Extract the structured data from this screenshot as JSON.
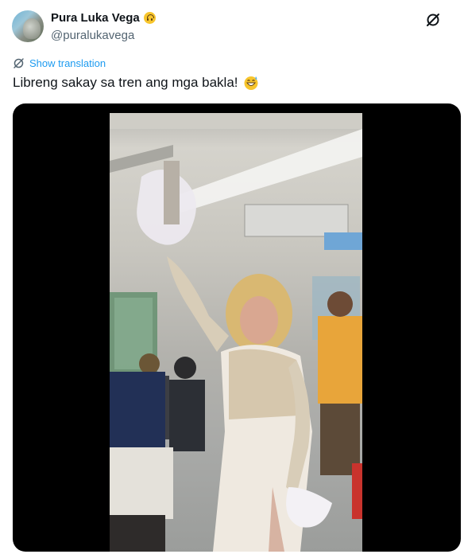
{
  "author": {
    "display_name": "Pura Luka Vega",
    "name_emoji": "upside-down-face-emoji",
    "handle": "@puralukavega",
    "avatar": "avatar-photo"
  },
  "header": {
    "grok_icon": "grok-icon"
  },
  "translation": {
    "icon": "translate-icon",
    "label": "Show translation"
  },
  "tweet": {
    "text": "Libreng sakay sa tren ang mga bakla!",
    "emoji": "grinning-face-with-sweat-emoji"
  },
  "media": {
    "type": "video",
    "description_icon": "video-thumbnail"
  },
  "colors": {
    "link": "#1d9bf0",
    "secondary_text": "#536471",
    "primary_text": "#0f1419",
    "media_background": "#000000"
  }
}
